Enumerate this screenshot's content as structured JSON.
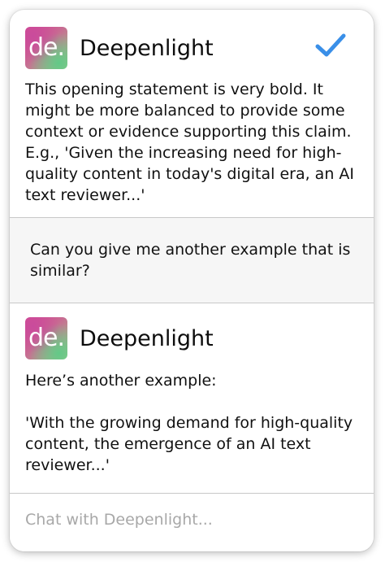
{
  "messages": [
    {
      "sender": "Deepenlight",
      "logo_text": "de.",
      "status_icon": "checkmark-icon",
      "text": "This opening statement is very bold. It might be more balanced to provide some context or evidence supporting this claim. E.g., 'Given the increasing need for high-quality content in today's digital era, an AI text reviewer...'"
    },
    {
      "sender": "user",
      "text": "Can you give me another example that is similar?"
    },
    {
      "sender": "Deepenlight",
      "logo_text": "de.",
      "text": "Here’s another example:\n\n'With the growing demand for high-quality content, the emergence of an AI text reviewer...'"
    }
  ],
  "chat_input": {
    "placeholder": "Chat with Deepenlight...",
    "value": ""
  },
  "colors": {
    "accent_check": "#3a8fe8",
    "divider": "#c8c8c8",
    "user_bubble_bg": "#f6f6f6",
    "placeholder": "#a8a8a8"
  }
}
